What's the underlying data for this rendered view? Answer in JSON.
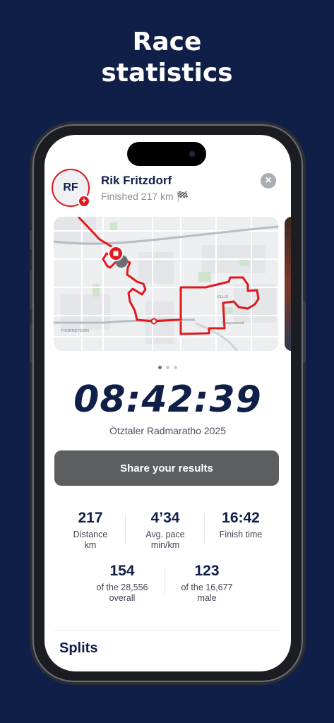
{
  "headline": {
    "line1": "Race",
    "line2": "statistics"
  },
  "profile": {
    "initials": "RF",
    "name": "Rik Fritzdorf",
    "status": "Finished 217 km 🏁"
  },
  "close_icon": "×",
  "map": {
    "labels": [
      "ELLIS",
      "THORNETOWN",
      "Sawyerwood"
    ]
  },
  "carousel": {
    "pages": 3,
    "active": 0
  },
  "result": {
    "time": "08:42:39",
    "event": "Ötztaler Radmaratho 2025"
  },
  "share_label": "Share your results",
  "stats": {
    "distance": {
      "value": "217",
      "label1": "Distance",
      "label2": "km"
    },
    "pace": {
      "value": "4’34",
      "label1": "Avg. pace",
      "label2": "min/km"
    },
    "finish": {
      "value": "16:42",
      "label1": "Finish time"
    },
    "overall": {
      "value": "154",
      "label1": "of the 28,556",
      "label2": "overall"
    },
    "gender": {
      "value": "123",
      "label1": "of the 16,677",
      "label2": "male"
    }
  },
  "splits_title": "Splits",
  "colors": {
    "background": "#0f1f47",
    "accent": "#e0191e",
    "button": "#5d5e60"
  }
}
